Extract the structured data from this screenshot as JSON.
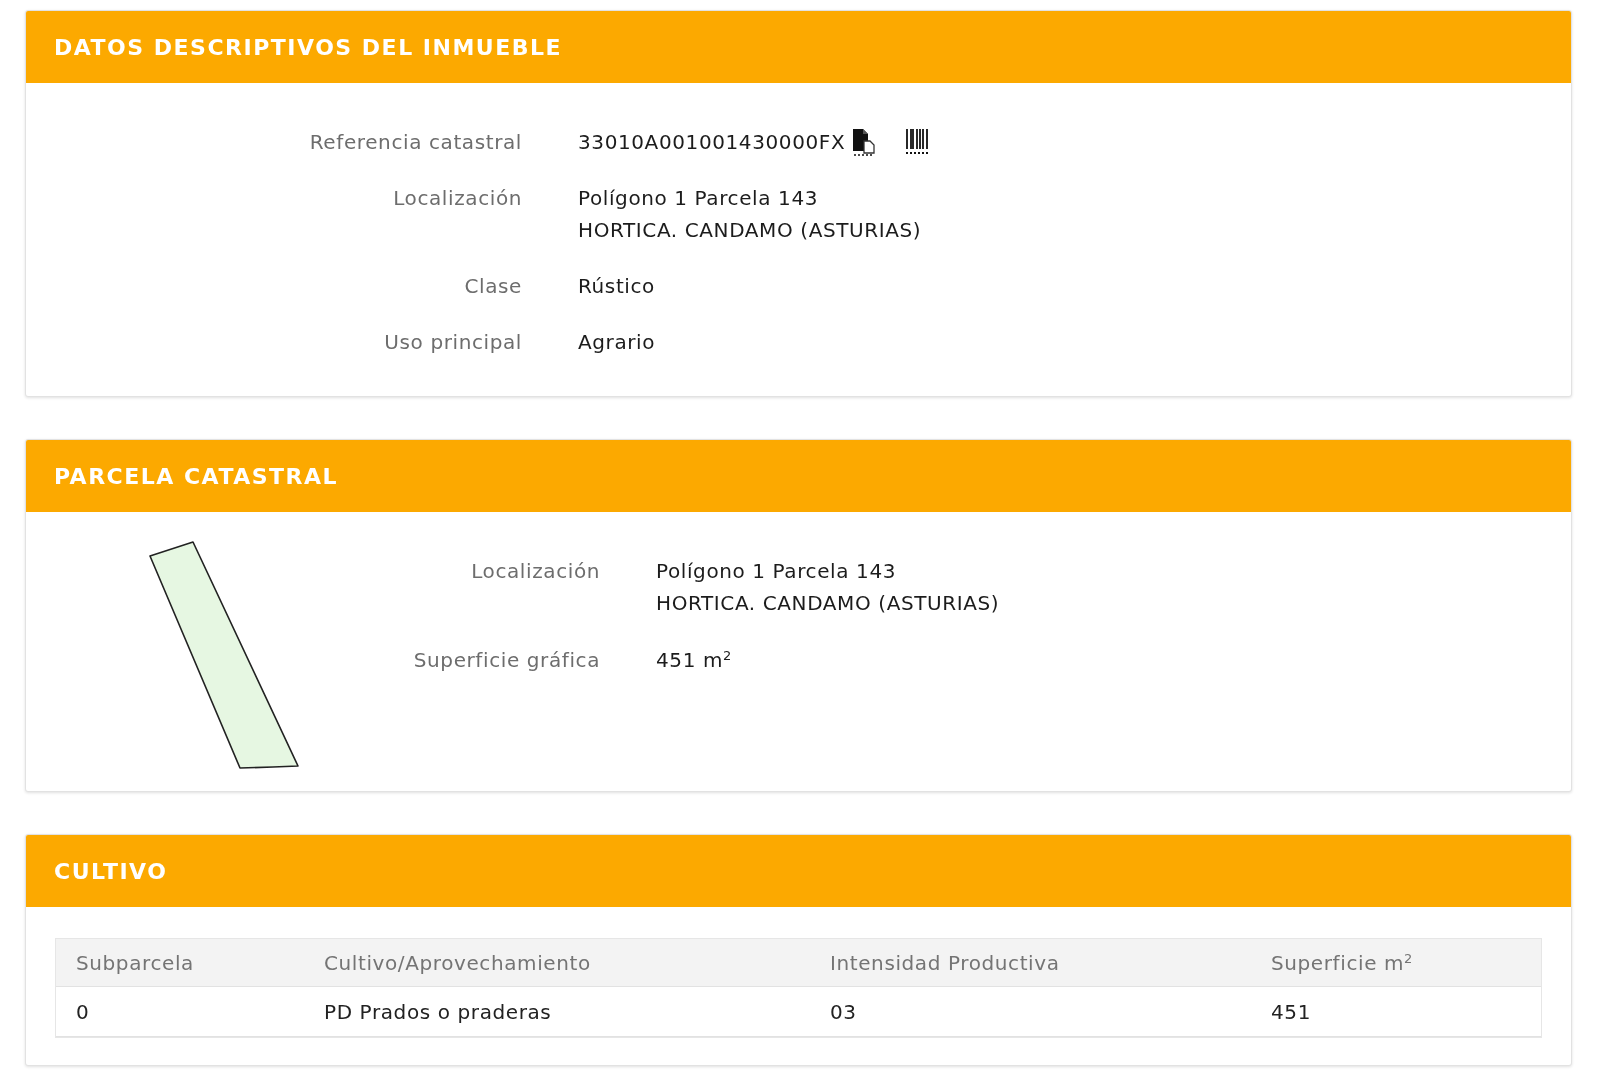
{
  "property_details": {
    "title": "DATOS DESCRIPTIVOS DEL INMUEBLE",
    "fields": [
      {
        "kind": "reference",
        "label": "Referencia catastral",
        "value_lines": [
          "33010A001001430000FX"
        ]
      },
      {
        "kind": "text",
        "label": "Localización",
        "value_lines": [
          "Polígono 1 Parcela 143",
          "HORTICA. CANDAMO (ASTURIAS)"
        ]
      },
      {
        "kind": "text",
        "label": "Clase",
        "value_lines": [
          "Rústico"
        ]
      },
      {
        "kind": "text",
        "label": "Uso principal",
        "value_lines": [
          "Agrario"
        ]
      }
    ]
  },
  "cadastral_parcel": {
    "title": "PARCELA CATASTRAL",
    "fields": [
      {
        "kind": "text",
        "label": "Localización",
        "value_lines": [
          "Polígono 1 Parcela 143",
          "HORTICA. CANDAMO (ASTURIAS)"
        ]
      },
      {
        "kind": "text",
        "label": "Superficie gráfica",
        "value_lines": [
          "451 m$^{2}$"
        ]
      }
    ]
  },
  "crop": {
    "title": "CULTIVO",
    "table": {
      "columns": [
        "Subparcela",
        "Cultivo/Aprovechamiento",
        "Intensidad Productiva",
        "Superficie m$^{2}$"
      ],
      "rows": [
        [
          "0",
          "PD Prados o praderas",
          "03",
          "451"
        ]
      ]
    }
  }
}
